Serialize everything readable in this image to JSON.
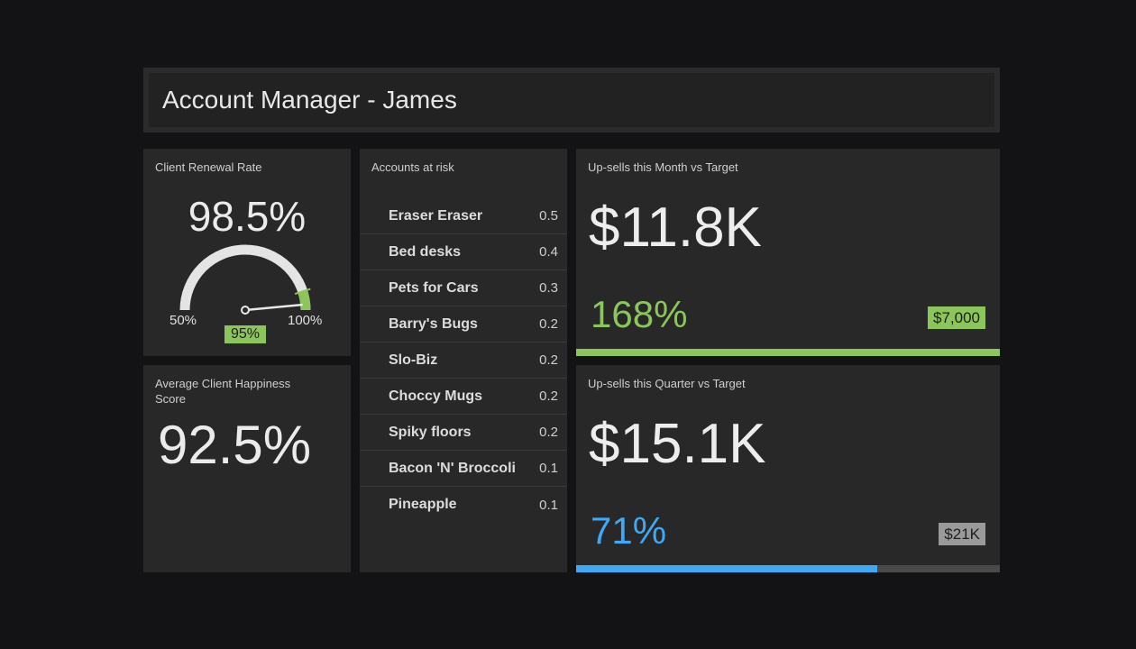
{
  "header": {
    "title": "Account Manager - James"
  },
  "renewal": {
    "title": "Client Renewal Rate",
    "value": "98.5%",
    "min_label": "50%",
    "max_label": "100%",
    "target_label": "95%",
    "value_fraction": 0.97,
    "target_fraction": 0.9,
    "accent": "#8cc65a"
  },
  "happiness": {
    "title": "Average Client Happiness Score",
    "value": "92.5%"
  },
  "risk": {
    "title": "Accounts at risk",
    "items": [
      {
        "name": "Eraser Eraser",
        "score": "0.5"
      },
      {
        "name": "Bed desks",
        "score": "0.4"
      },
      {
        "name": "Pets for Cars",
        "score": "0.3"
      },
      {
        "name": "Barry's Bugs",
        "score": "0.2"
      },
      {
        "name": "Slo-Biz",
        "score": "0.2"
      },
      {
        "name": "Choccy Mugs",
        "score": "0.2"
      },
      {
        "name": "Spiky floors",
        "score": "0.2"
      },
      {
        "name": "Bacon 'N' Broccoli",
        "score": "0.1"
      },
      {
        "name": "Pineapple",
        "score": "0.1"
      }
    ]
  },
  "month": {
    "title": "Up-sells this Month vs Target",
    "value": "$11.8K",
    "percent": "168%",
    "target": "$7,000",
    "progress": 1.0,
    "color": "#8cc65a",
    "target_bg": "#8cc65a"
  },
  "quarter": {
    "title": "Up-sells this Quarter vs Target",
    "value": "$15.1K",
    "percent": "71%",
    "target": "$21K",
    "progress": 0.71,
    "color": "#3fa9f5",
    "target_bg": "#9a9a9a"
  }
}
